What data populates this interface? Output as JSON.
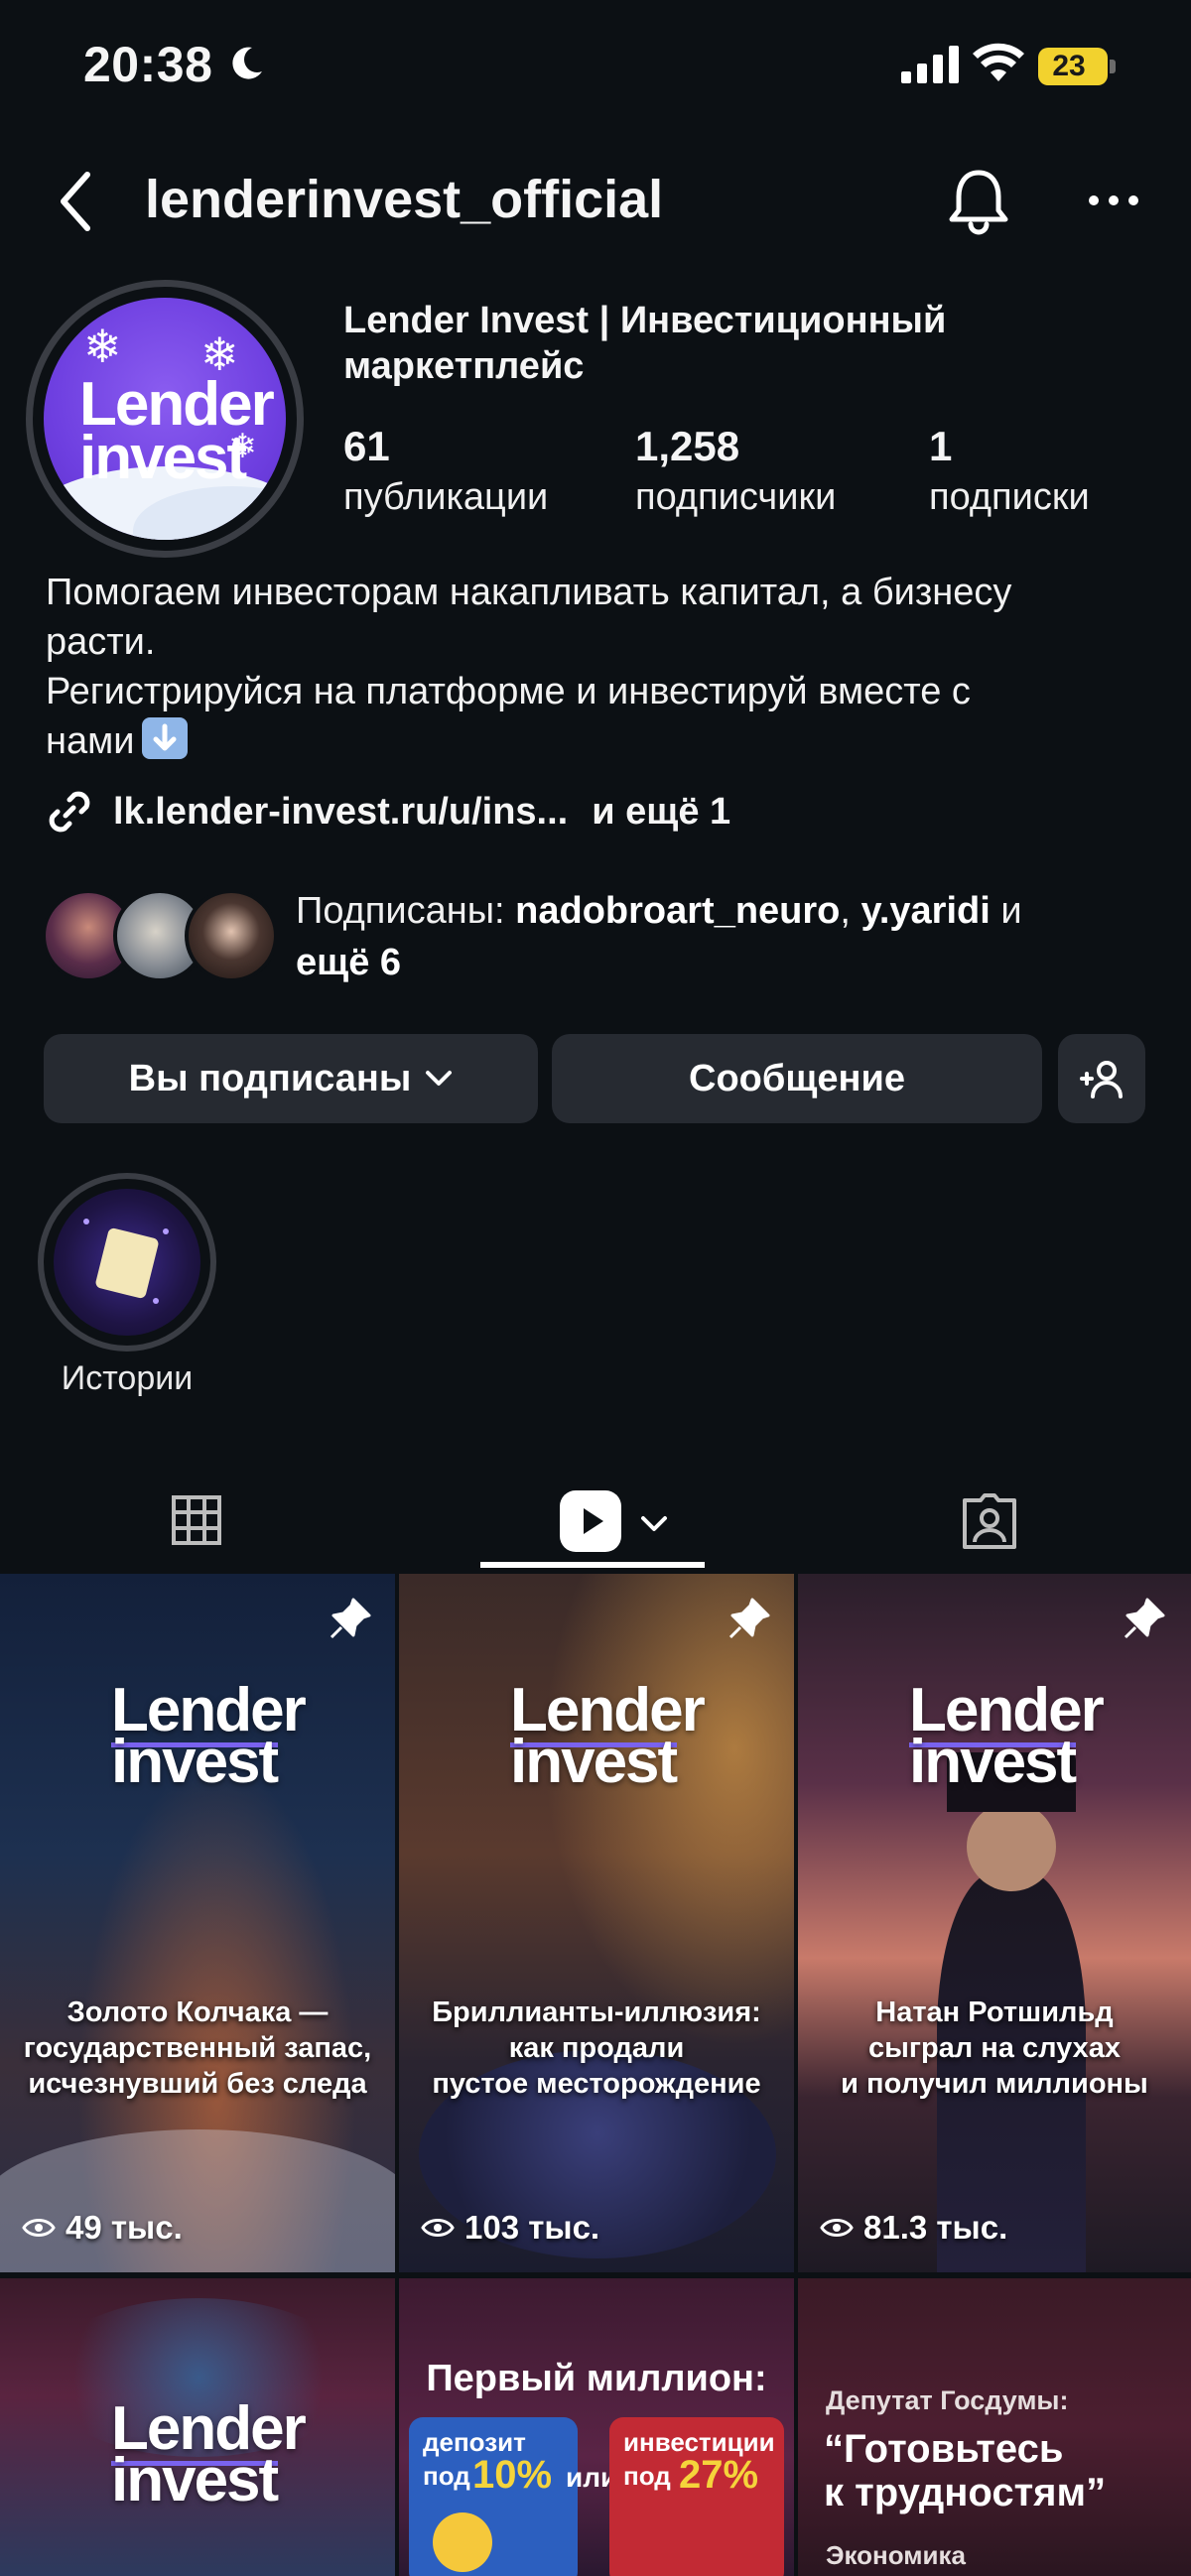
{
  "status_bar": {
    "time": "20:38",
    "battery": "23"
  },
  "header": {
    "username": "lenderinvest_official"
  },
  "profile": {
    "avatar_logo_line1": "Lender",
    "avatar_logo_line2": "invest",
    "full_name": "Lender Invest | Инвестиционный маркетплейс",
    "stats": [
      {
        "value": "61",
        "label": "публикации"
      },
      {
        "value": "1,258",
        "label": "подписчики"
      },
      {
        "value": "1",
        "label": "подписки"
      }
    ],
    "bio_lines": [
      "Помогаем инвесторам накапливать капитал, а бизнесу",
      "расти.",
      "Регистрируйся на платформе и инвестируй вместе с",
      "нами"
    ],
    "link_text": "lk.lender-invest.ru/u/ins...",
    "link_more": "и ещё 1",
    "followed_by": {
      "prefix": "Подписаны:",
      "user1": "nadobroart_neuro",
      "separator": ",",
      "user2": "y.yaridi",
      "and": "и",
      "more": "ещё 6"
    }
  },
  "buttons": {
    "following": "Вы подписаны",
    "message": "Сообщение"
  },
  "highlights": [
    {
      "label": "Истории"
    }
  ],
  "icons": {
    "back": "chevron-left-icon",
    "bell": "bell-icon",
    "more": "more-horizontal-icon",
    "link": "link-icon",
    "add_user": "add-user-icon",
    "grid_tab": "grid-icon",
    "reels_tab": "reels-icon",
    "tagged_tab": "tagged-icon",
    "pin": "pin-icon",
    "views": "eye-icon"
  },
  "reels": [
    {
      "logo1": "Lender",
      "logo2": "invest",
      "caption_lines": [
        "Золото Колчака —",
        "государственный запас,",
        "исчезнувший без следа"
      ],
      "views": "49 тыс.",
      "pinned": true
    },
    {
      "logo1": "Lender",
      "logo2": "invest",
      "caption_lines": [
        "Бриллианты-иллюзия:",
        "как продали",
        "пустое месторождение"
      ],
      "views": "103 тыс.",
      "pinned": true
    },
    {
      "logo1": "Lender",
      "logo2": "invest",
      "caption_lines": [
        "Натан Ротшильд",
        "сыграл на слухах",
        "и получил миллионы"
      ],
      "views": "81.3 тыс.",
      "pinned": true
    },
    {
      "logo1": "Lender",
      "logo2": "invest"
    },
    {
      "headline": "Первый миллион:",
      "box1_line1": "депозит",
      "box1_line2": "под",
      "box1_pct": "10%",
      "middle": "или",
      "box2_line1": "инвестиции",
      "box2_line2": "под",
      "box2_pct": "27%"
    },
    {
      "kicker": "Депутат Госдумы:",
      "quote_line1": "“Готовьтесь",
      "quote_line2": "к трудностям”",
      "footer": "Экономика"
    }
  ],
  "colors": {
    "background": "#0c1014",
    "button": "#262a31",
    "accent": "#7a63f0",
    "battery": "#f2d22e"
  }
}
